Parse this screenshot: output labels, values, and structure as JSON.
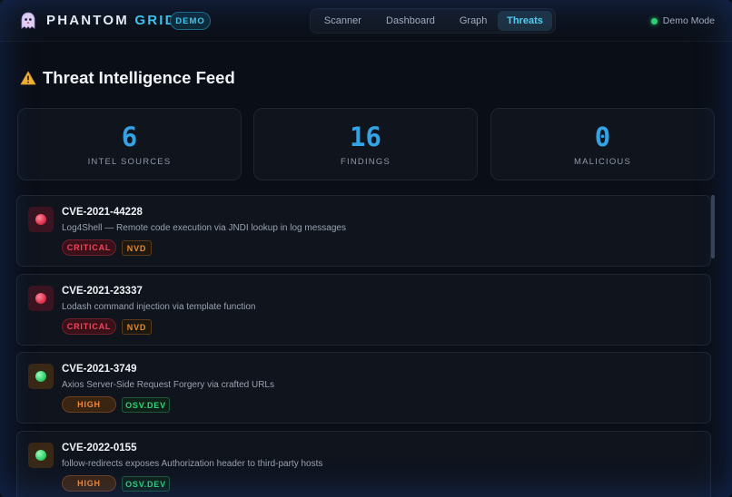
{
  "header": {
    "brand_main": "PHANTOM ",
    "brand_accent": "GRID",
    "badge": "DEMO",
    "nav": [
      {
        "label": "Scanner",
        "active": false
      },
      {
        "label": "Dashboard",
        "active": false
      },
      {
        "label": "Graph",
        "active": false
      },
      {
        "label": "Threats",
        "active": true
      }
    ],
    "mode_label": "Demo Mode"
  },
  "page": {
    "title": "Threat Intelligence Feed",
    "title_icon": "warning-icon"
  },
  "stats": [
    {
      "value": "6",
      "label": "INTEL SOURCES"
    },
    {
      "value": "16",
      "label": "FINDINGS"
    },
    {
      "value": "0",
      "label": "MALICIOUS"
    }
  ],
  "threats": [
    {
      "id": "CVE-2021-44228",
      "description": "Log4Shell — Remote code execution via JNDI lookup in log messages",
      "severity": "CRITICAL",
      "source": "NVD",
      "indicator": "red"
    },
    {
      "id": "CVE-2021-23337",
      "description": "Lodash command injection via template function",
      "severity": "CRITICAL",
      "source": "NVD",
      "indicator": "red"
    },
    {
      "id": "CVE-2021-3749",
      "description": "Axios Server-Side Request Forgery via crafted URLs",
      "severity": "HIGH",
      "source": "OSV.DEV",
      "indicator": "green"
    },
    {
      "id": "CVE-2022-0155",
      "description": "follow-redirects exposes Authorization header to third-party hosts",
      "severity": "HIGH",
      "source": "OSV.DEV",
      "indicator": "green"
    }
  ],
  "colors": {
    "accent": "#3ec7ef",
    "stat_number": "#33a3e6",
    "critical": "#f0445e",
    "high": "#f08a3a",
    "status_ok": "#2ed46e"
  }
}
